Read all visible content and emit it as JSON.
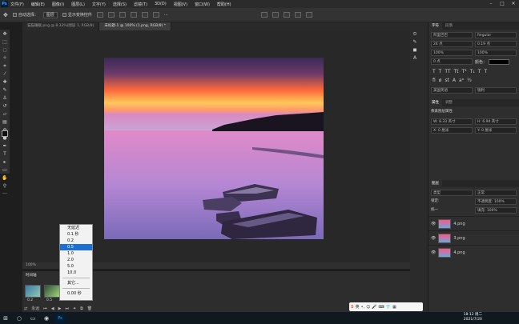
{
  "menubar": {
    "items": [
      "文件(F)",
      "编辑(E)",
      "图像(I)",
      "图层(L)",
      "文字(Y)",
      "选择(S)",
      "滤镜(T)",
      "3D(D)",
      "视图(V)",
      "窗口(W)",
      "帮助(H)"
    ]
  },
  "options": {
    "auto_select": "自动选择：",
    "layer_select": "图层",
    "show_transform": "显示变换控件"
  },
  "tabs": [
    "猫猫睡眠.png @ 8.33%(图层 1, RGB/8)",
    "未标题-1 @ 100% (1.png, RGB/8) *"
  ],
  "status": {
    "zoom": "100%"
  },
  "timeline": {
    "title": "时间轴",
    "frame1_delay": "0.2",
    "frame2_delay": "0.5",
    "loop": "永远"
  },
  "delay_menu": {
    "items": [
      "无延迟",
      "0.1 秒",
      "0.2",
      "0.5",
      "1.0",
      "2.0",
      "5.0",
      "10.0"
    ],
    "selected": "0.5",
    "other": "其它...",
    "current": "0.00 秒"
  },
  "character_panel": {
    "tabs": [
      "字符",
      "段落"
    ],
    "font": "阿里巴巴",
    "style": "Regular",
    "size": "24 点",
    "leading": "0.19 点",
    "tracking": "100%",
    "vscale": "100%",
    "baseline": "0 点",
    "color_label": "颜色：",
    "lang": "美国英语",
    "aa": "锐利"
  },
  "properties": {
    "tabs": [
      "属性",
      "调整"
    ],
    "title": "像素图层属性",
    "w": "W: 8.33 英寸",
    "h": "H: 6.94 英寸",
    "x": "X: 0 厘米",
    "y": "Y: 0 厘米"
  },
  "layers": {
    "tab": "图层",
    "kind": "类型",
    "mode": "正常",
    "opacity": "不透明度: 100%",
    "lock": "锁定:",
    "fill": "填充: 100%",
    "rows": [
      "4.png",
      "3.png",
      "4.png"
    ],
    "row_flag": "统一"
  },
  "taskbar": {
    "time": "18:12 周二",
    "date": "2021/7/20"
  },
  "ime": {
    "label": "英"
  }
}
